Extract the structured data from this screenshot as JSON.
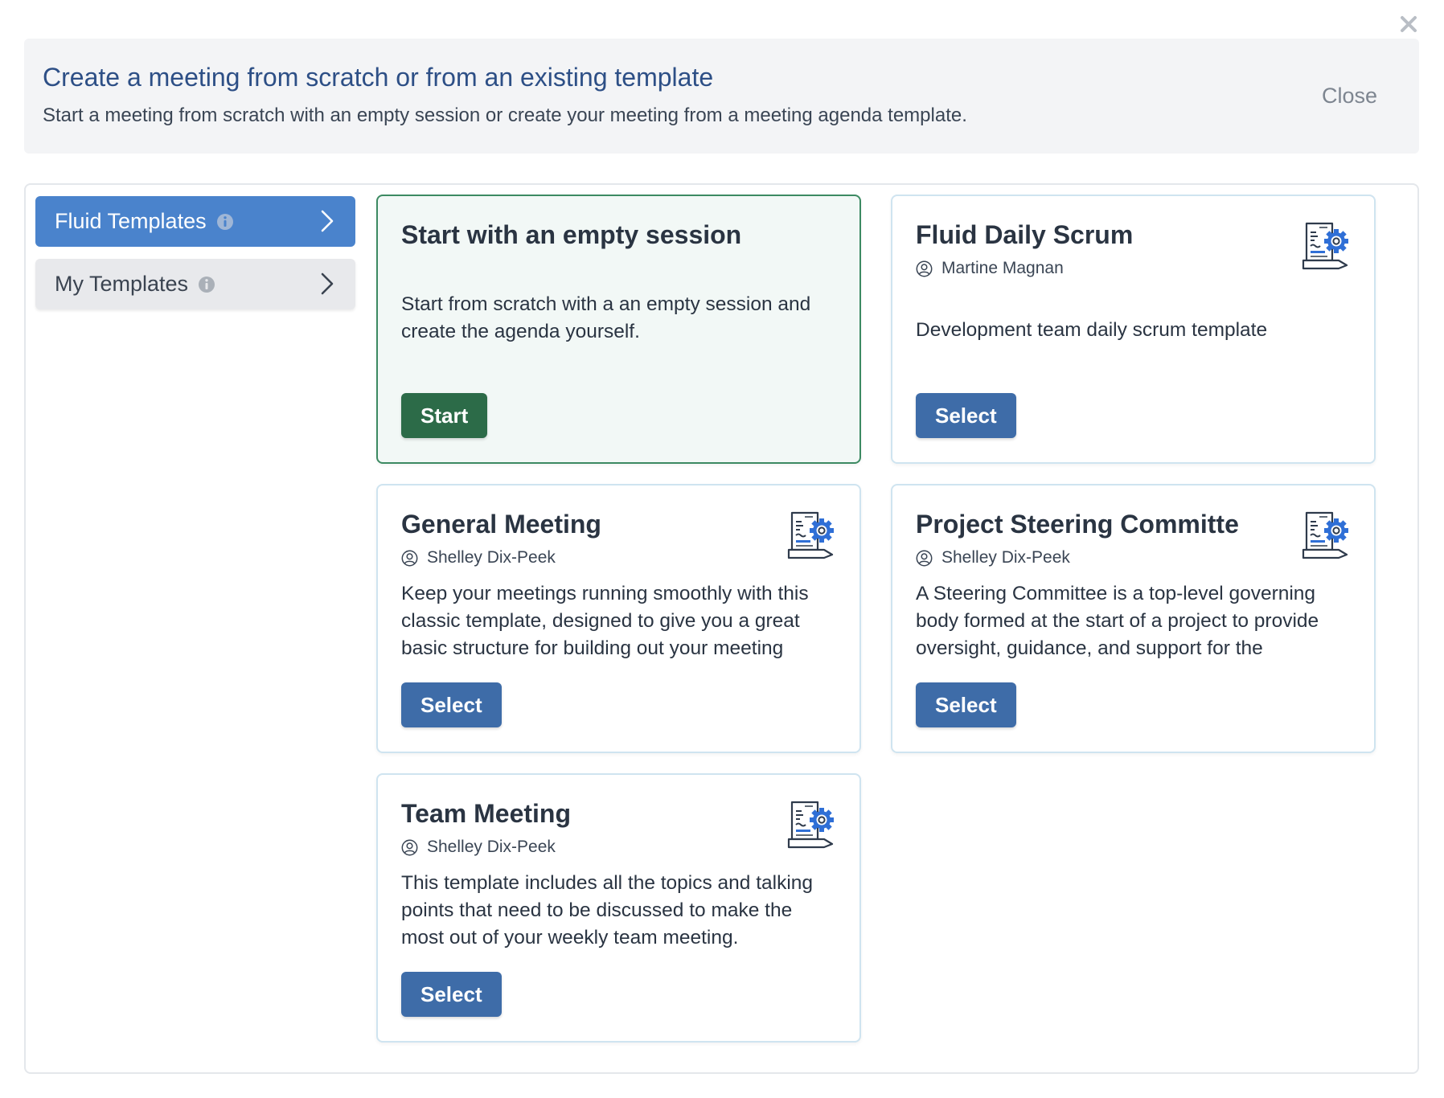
{
  "dialog": {
    "title": "Create a meeting from scratch or from an existing template",
    "subtitle": "Start a meeting from scratch with an empty session or create your meeting from a meeting agenda template.",
    "close_label": "Close"
  },
  "sidebar": {
    "items": [
      {
        "label": "Fluid Templates",
        "active": true
      },
      {
        "label": "My Templates",
        "active": false
      }
    ]
  },
  "empty_session": {
    "title": "Start with an empty session",
    "description": "Start from scratch with a an empty session and create the agenda yourself.",
    "button_label": "Start"
  },
  "templates": [
    {
      "title": "Fluid Daily Scrum",
      "author": "Martine Magnan",
      "description": "Development team daily scrum template",
      "button_label": "Select"
    },
    {
      "title": "General Meeting",
      "author": "Shelley Dix-Peek",
      "description": "Keep your meetings running smoothly with this classic template, designed to give you a great basic structure for building out your meeting",
      "button_label": "Select"
    },
    {
      "title": "Project Steering Committe",
      "author": "Shelley Dix-Peek",
      "description": "A Steering Committee is a top-level governing body formed at the start of a project to provide oversight, guidance, and support for the",
      "button_label": "Select"
    },
    {
      "title": "Team Meeting",
      "author": "Shelley Dix-Peek",
      "description": "This template includes all the topics and talking points that need to be discussed to make the most out of your weekly team meeting.",
      "button_label": "Select"
    }
  ],
  "colors": {
    "accent_blue": "#4a83cc",
    "select_button": "#3e6ca8",
    "start_button": "#2c6b48",
    "title_blue": "#2d4f86"
  },
  "icons": [
    "close-x-icon",
    "info-icon",
    "chevron-right-icon",
    "user-circle-icon",
    "template-document-gear-icon"
  ]
}
